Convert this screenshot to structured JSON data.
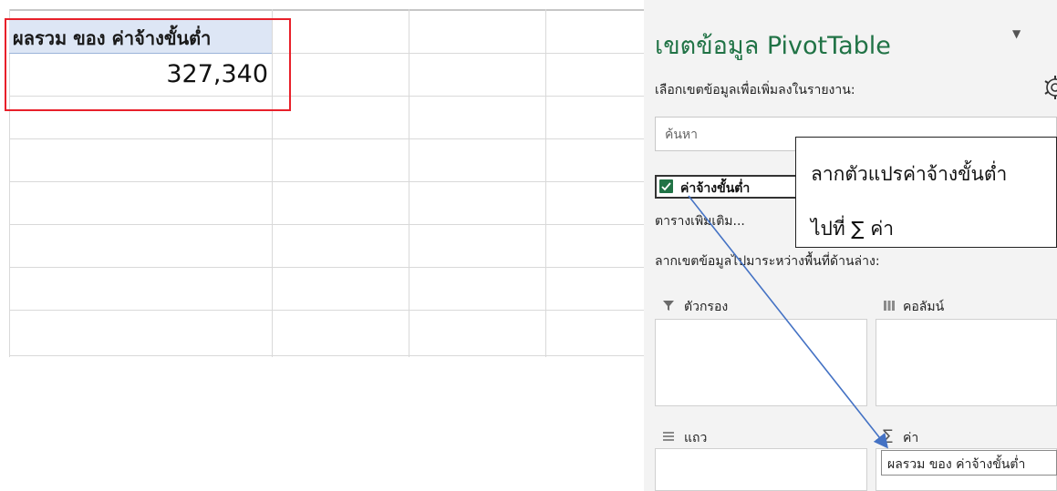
{
  "sheet": {
    "pivot_header": "ผลรวม ของ ค่าจ้างขั้นต่ำ",
    "pivot_value": "327,340"
  },
  "pane": {
    "title": "เขตข้อมูล PivotTable",
    "subtitle": "เลือกเขตข้อมูลเพื่อเพิ่มลงในรายงาน:",
    "search_placeholder": "ค้นหา",
    "field_label": "ค่าจ้างขั้นต่ำ",
    "field_checked": true,
    "more_tables": "ตารางเพิ่มเติม...",
    "drag_hint": "ลากเขตข้อมูลไปมาระหว่างพื้นที่ด้านล่าง:",
    "areas": {
      "filters": "ตัวกรอง",
      "columns": "คอลัมน์",
      "rows": "แถว",
      "values": "ค่า"
    },
    "value_item": "ผลรวม ของ ค่าจ้างขั้นต่ำ"
  },
  "callout": {
    "line1": "ลากตัวแปรค่าจ้างขั้นต่ำ",
    "line2": "ไปที่  ∑  ค่า"
  },
  "colors": {
    "excel_green": "#217346",
    "highlight_red": "#e8202a",
    "arrow_blue": "#4472c4",
    "header_fill": "#dde6f5"
  }
}
